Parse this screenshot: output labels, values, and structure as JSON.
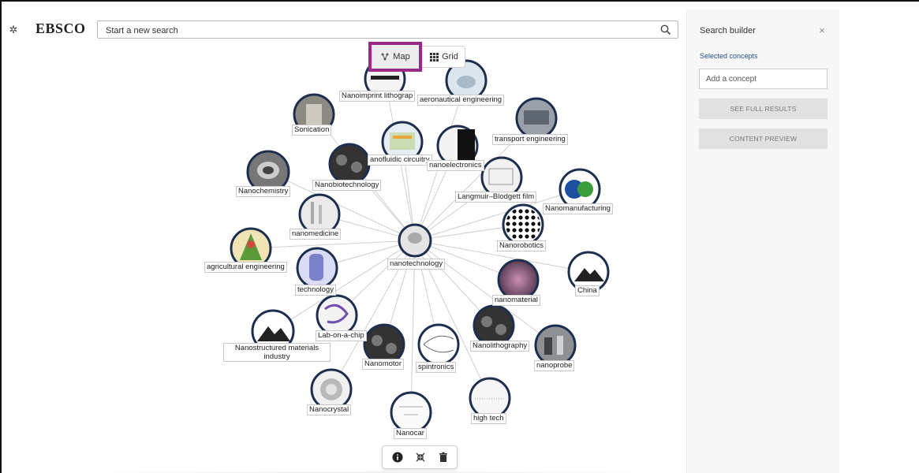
{
  "header": {
    "brand": "EBSCO",
    "search_placeholder": "Start a new search",
    "settings_icon": "gear-icon",
    "search_icon": "search-icon"
  },
  "view_toggle": {
    "map_label": "Map",
    "grid_label": "Grid",
    "active": "Map",
    "highlight_color": "#9a2a87"
  },
  "panel": {
    "title": "Search builder",
    "close_glyph": "×",
    "selected_label": "Selected concepts",
    "concept_placeholder": "Add a concept",
    "full_results_label": "SEE FULL RESULTS",
    "preview_label": "CONTENT PREVIEW"
  },
  "map": {
    "center": "nanotechnology",
    "nodes": [
      "Nanoimprint lithograp",
      "aeronautical engineering",
      "Sonication",
      "transport engineering",
      "anofluidic circuitry",
      "nanoelectronics",
      "Nanochemistry",
      "Nanobiotechnology",
      "Langmuir–Blodgett film",
      "Nanomanufacturing",
      "nanomedicine",
      "Nanorobotics",
      "agricultural engineering",
      "technology",
      "China",
      "nanomaterial",
      "Lab-on-a-chip",
      "Nanostructured materials industry",
      "Nanomotor",
      "spintronics",
      "Nanolithography",
      "nanoprobe",
      "Nanocrystal",
      "Nanocar",
      "high tech"
    ]
  },
  "toolbar": {
    "icons": [
      "info-icon",
      "collapse-icon",
      "trash-icon"
    ]
  }
}
